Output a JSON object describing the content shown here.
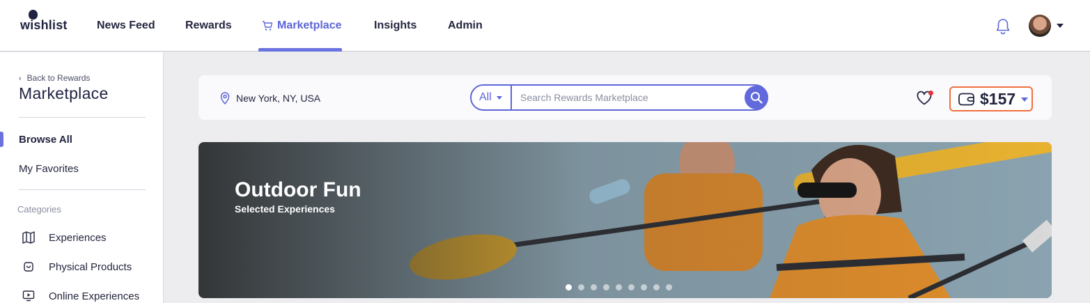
{
  "brand": {
    "logo_text": "wishlist"
  },
  "nav": {
    "items": [
      {
        "label": "News Feed"
      },
      {
        "label": "Rewards"
      },
      {
        "label": "Marketplace"
      },
      {
        "label": "Insights"
      },
      {
        "label": "Admin"
      }
    ],
    "active": "Marketplace"
  },
  "sidebar": {
    "back_label": "Back to Rewards",
    "title": "Marketplace",
    "links": [
      {
        "label": "Browse All",
        "active": true
      },
      {
        "label": "My Favorites",
        "active": false
      }
    ],
    "categories_heading": "Categories",
    "categories": [
      {
        "label": "Experiences",
        "icon": "map-icon"
      },
      {
        "label": "Physical Products",
        "icon": "bag-icon"
      },
      {
        "label": "Online Experiences",
        "icon": "monitor-play-icon"
      }
    ]
  },
  "searchbar": {
    "location": "New York, NY, USA",
    "category_value": "All",
    "placeholder": "Search Rewards Marketplace",
    "query": ""
  },
  "wallet": {
    "balance": "$157"
  },
  "hero": {
    "title": "Outdoor Fun",
    "subtitle": "Selected Experiences",
    "slide_count": 9,
    "active_slide": 1
  },
  "colors": {
    "accent": "#5d66d6",
    "wallet_border": "#f06e3f",
    "notification_dot": "#e2313a"
  }
}
